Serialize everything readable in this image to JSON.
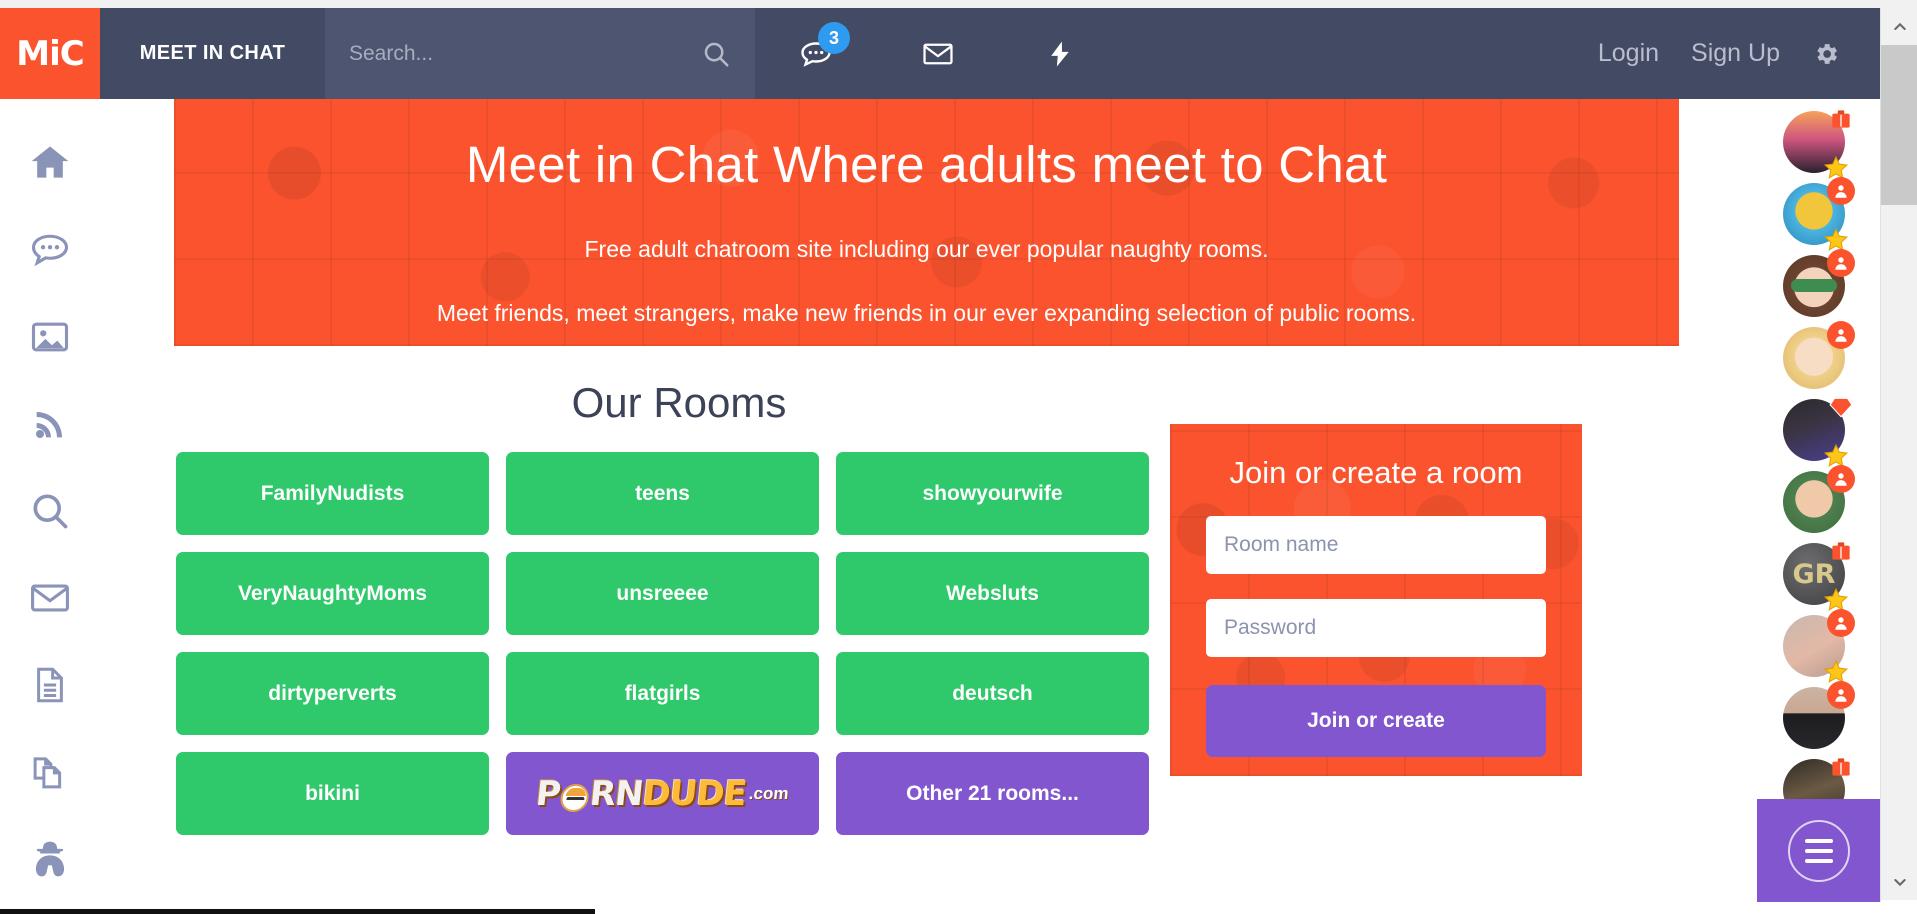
{
  "header": {
    "logo_text": "MiC",
    "brand": "MEET IN CHAT",
    "search_placeholder": "Search...",
    "search_value": "",
    "chat_badge": "3",
    "icons": [
      "search-icon",
      "chat-bubble-icon",
      "envelope-icon",
      "lightning-bolt-icon"
    ],
    "login_label": "Login",
    "signup_label": "Sign Up",
    "settings_icon": "gear-icon"
  },
  "sidebar": {
    "items": [
      {
        "icon": "home-icon",
        "name": "home"
      },
      {
        "icon": "chat-bubble-icon",
        "name": "chat"
      },
      {
        "icon": "image-icon",
        "name": "gallery"
      },
      {
        "icon": "rss-feed-icon",
        "name": "feed"
      },
      {
        "icon": "search-icon",
        "name": "search"
      },
      {
        "icon": "envelope-icon",
        "name": "messages"
      },
      {
        "icon": "document-icon",
        "name": "pages"
      },
      {
        "icon": "copy-pages-icon",
        "name": "documents"
      },
      {
        "icon": "spy-incognito-icon",
        "name": "incognito"
      }
    ]
  },
  "hero": {
    "title": "Meet in Chat Where adults meet to Chat",
    "subtitle1": "Free adult chatroom site including our ever popular naughty rooms.",
    "subtitle2": "Meet friends, meet strangers, make new friends in our ever expanding selection of public rooms."
  },
  "rooms": {
    "heading": "Our Rooms",
    "items": [
      {
        "label": "FamilyNudists",
        "kind": "room"
      },
      {
        "label": "teens",
        "kind": "room"
      },
      {
        "label": "showyourwife",
        "kind": "room"
      },
      {
        "label": "VeryNaughtyMoms",
        "kind": "room"
      },
      {
        "label": "unsreeee",
        "kind": "room"
      },
      {
        "label": "Websluts",
        "kind": "room"
      },
      {
        "label": "dirtyperverts",
        "kind": "room"
      },
      {
        "label": "flatgirls",
        "kind": "room"
      },
      {
        "label": "deutsch",
        "kind": "room"
      },
      {
        "label": "bikini",
        "kind": "room"
      },
      {
        "label": "PORNDUDE.com",
        "kind": "ad"
      },
      {
        "label": "Other 21 rooms...",
        "kind": "more"
      }
    ],
    "ad": {
      "word1": "P",
      "word1b": "RN",
      "word2": "DUDE",
      "suffix": ".com"
    }
  },
  "join": {
    "title": "Join or create a room",
    "room_placeholder": "Room name",
    "room_value": "",
    "password_placeholder": "Password",
    "password_value": "",
    "button_label": "Join or create"
  },
  "rail": {
    "users": [
      {
        "badge": "suitcase",
        "star": true,
        "bg": "sunset-beach"
      },
      {
        "badge": "person",
        "star": true,
        "bg": "cocktail"
      },
      {
        "badge": "person",
        "star": false,
        "bg": "avatar-sunglasses"
      },
      {
        "badge": "person",
        "star": false,
        "bg": "avatar-blonde"
      },
      {
        "badge": "diamond",
        "star": true,
        "bg": "photo-dark"
      },
      {
        "badge": "person",
        "star": false,
        "bg": "avatar-man"
      },
      {
        "badge": "suitcase",
        "star": true,
        "bg": "gr-initials",
        "initials": "GR"
      },
      {
        "badge": "person",
        "star": true,
        "bg": "photo-skin"
      },
      {
        "badge": "person",
        "star": false,
        "bg": "photo-black-shorts"
      },
      {
        "badge": "suitcase",
        "star": false,
        "bg": "photo-table"
      }
    ],
    "fab_icon": "hamburger-menu-icon"
  },
  "colors": {
    "orange": "#fa532e",
    "header_dark": "#434a63",
    "green": "#2fc96b",
    "purple": "#8156cf",
    "badge_blue": "#2f9bf0",
    "star_yellow": "#ffc61a"
  }
}
